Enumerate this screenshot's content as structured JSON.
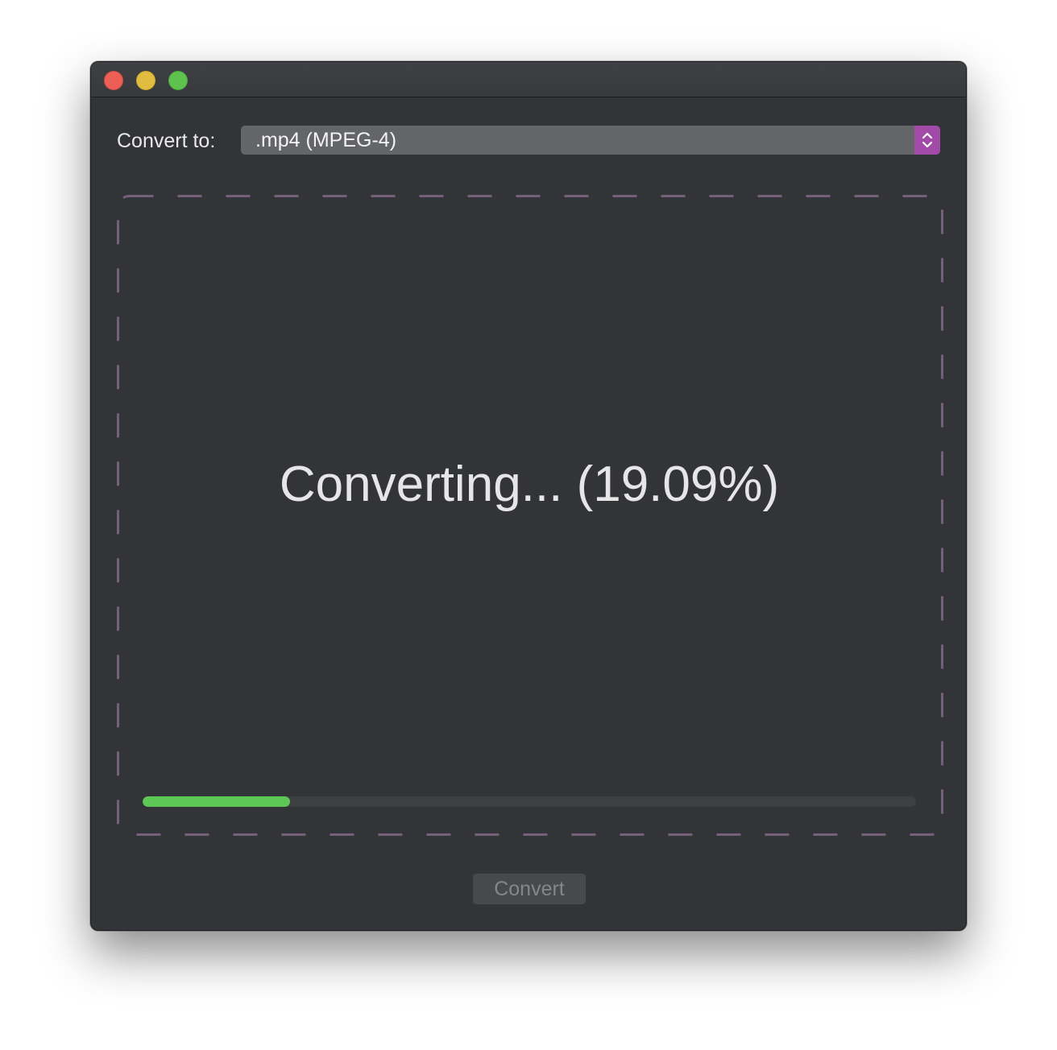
{
  "window": {
    "controls": [
      "close",
      "minimize",
      "maximize"
    ]
  },
  "converter": {
    "label": "Convert to:",
    "selected_format": ".mp4 (MPEG-4)"
  },
  "status": {
    "text": "Converting... (19.09%)",
    "progress": 0.1909
  },
  "actions": {
    "convert_label": "Convert",
    "convert_enabled": false
  },
  "colors": {
    "accent": "#a14aa8",
    "progress": "#5ec857",
    "drop_border": "#75607a",
    "background": "#323438"
  }
}
